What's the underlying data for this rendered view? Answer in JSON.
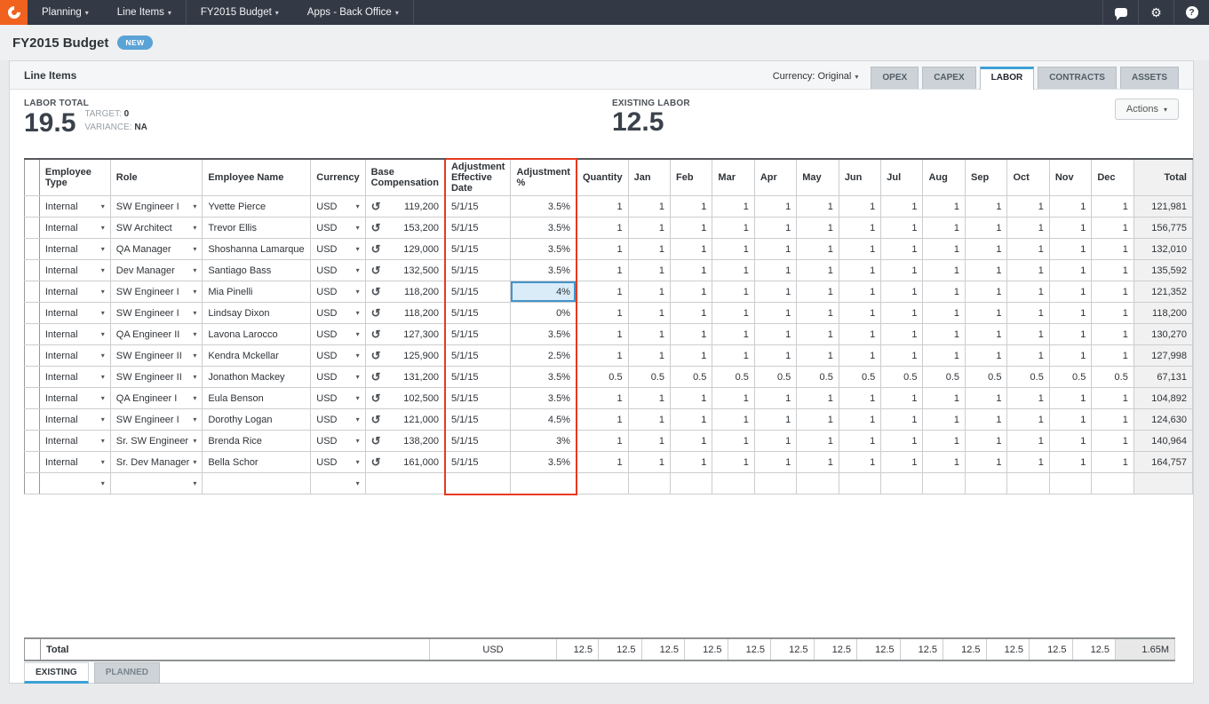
{
  "colors": {
    "navbar_bg": "#333a46",
    "logo_orange": "#f1621f",
    "badge_blue": "#5ba3d6",
    "active_tab_accent": "#3da0d5",
    "adjustment_columns_highlight": "#e8391f",
    "selected_cell_fill": "#d9ecf7",
    "selected_cell_border": "#4494cb"
  },
  "navbar": {
    "menu_groups": [
      {
        "items": [
          {
            "label": "Planning"
          },
          {
            "label": "Line Items"
          }
        ]
      },
      {
        "items": [
          {
            "label": "FY2015 Budget"
          },
          {
            "label": "Apps - Back Office"
          }
        ]
      }
    ],
    "icons": [
      "chat-icon",
      "gear-icon",
      "help-icon"
    ]
  },
  "page": {
    "title": "FY2015 Budget",
    "badge": "NEW"
  },
  "panel": {
    "title": "Line Items",
    "currency_label": "Currency: Original",
    "tabs": [
      {
        "label": "OPEX",
        "active": false
      },
      {
        "label": "CAPEX",
        "active": false
      },
      {
        "label": "LABOR",
        "active": true
      },
      {
        "label": "CONTRACTS",
        "active": false
      },
      {
        "label": "ASSETS",
        "active": false
      }
    ],
    "actions_label": "Actions"
  },
  "summary": {
    "labor_total_label": "LABOR TOTAL",
    "labor_total_value": "19.5",
    "target_label": "TARGET:",
    "target_value": "0",
    "variance_label": "VARIANCE:",
    "variance_value": "NA",
    "existing_labor_label": "EXISTING LABOR",
    "existing_labor_value": "12.5"
  },
  "grid": {
    "columns": {
      "employee_type": "Employee Type",
      "role": "Role",
      "employee_name": "Employee Name",
      "currency": "Currency",
      "base_compensation": "Base Compensation",
      "adjustment_effective_date": "Adjustment Effective Date",
      "adjustment_pct": "Adjustment %",
      "quantity": "Quantity",
      "months": [
        "Jan",
        "Feb",
        "Mar",
        "Apr",
        "May",
        "Jun",
        "Jul",
        "Aug",
        "Sep",
        "Oct",
        "Nov",
        "Dec"
      ],
      "total": "Total"
    },
    "rows": [
      {
        "employee_type": "Internal",
        "role": "SW Engineer I",
        "employee_name": "Yvette Pierce",
        "currency": "USD",
        "base_compensation": "119,200",
        "adjustment_effective_date": "5/1/15",
        "adjustment_pct": "3.5%",
        "quantity": "1",
        "months": [
          "1",
          "1",
          "1",
          "1",
          "1",
          "1",
          "1",
          "1",
          "1",
          "1",
          "1",
          "1"
        ],
        "total": "121,981",
        "selected": false
      },
      {
        "employee_type": "Internal",
        "role": "SW Architect",
        "employee_name": "Trevor Ellis",
        "currency": "USD",
        "base_compensation": "153,200",
        "adjustment_effective_date": "5/1/15",
        "adjustment_pct": "3.5%",
        "quantity": "1",
        "months": [
          "1",
          "1",
          "1",
          "1",
          "1",
          "1",
          "1",
          "1",
          "1",
          "1",
          "1",
          "1"
        ],
        "total": "156,775",
        "selected": false
      },
      {
        "employee_type": "Internal",
        "role": "QA Manager",
        "employee_name": "Shoshanna Lamarque",
        "currency": "USD",
        "base_compensation": "129,000",
        "adjustment_effective_date": "5/1/15",
        "adjustment_pct": "3.5%",
        "quantity": "1",
        "months": [
          "1",
          "1",
          "1",
          "1",
          "1",
          "1",
          "1",
          "1",
          "1",
          "1",
          "1",
          "1"
        ],
        "total": "132,010",
        "selected": false
      },
      {
        "employee_type": "Internal",
        "role": "Dev Manager",
        "employee_name": "Santiago Bass",
        "currency": "USD",
        "base_compensation": "132,500",
        "adjustment_effective_date": "5/1/15",
        "adjustment_pct": "3.5%",
        "quantity": "1",
        "months": [
          "1",
          "1",
          "1",
          "1",
          "1",
          "1",
          "1",
          "1",
          "1",
          "1",
          "1",
          "1"
        ],
        "total": "135,592",
        "selected": false
      },
      {
        "employee_type": "Internal",
        "role": "SW Engineer I",
        "employee_name": "Mia Pinelli",
        "currency": "USD",
        "base_compensation": "118,200",
        "adjustment_effective_date": "5/1/15",
        "adjustment_pct": "4%",
        "quantity": "1",
        "months": [
          "1",
          "1",
          "1",
          "1",
          "1",
          "1",
          "1",
          "1",
          "1",
          "1",
          "1",
          "1"
        ],
        "total": "121,352",
        "selected": true
      },
      {
        "employee_type": "Internal",
        "role": "SW Engineer I",
        "employee_name": "Lindsay Dixon",
        "currency": "USD",
        "base_compensation": "118,200",
        "adjustment_effective_date": "5/1/15",
        "adjustment_pct": "0%",
        "quantity": "1",
        "months": [
          "1",
          "1",
          "1",
          "1",
          "1",
          "1",
          "1",
          "1",
          "1",
          "1",
          "1",
          "1"
        ],
        "total": "118,200",
        "selected": false
      },
      {
        "employee_type": "Internal",
        "role": "QA Engineer II",
        "employee_name": "Lavona Larocco",
        "currency": "USD",
        "base_compensation": "127,300",
        "adjustment_effective_date": "5/1/15",
        "adjustment_pct": "3.5%",
        "quantity": "1",
        "months": [
          "1",
          "1",
          "1",
          "1",
          "1",
          "1",
          "1",
          "1",
          "1",
          "1",
          "1",
          "1"
        ],
        "total": "130,270",
        "selected": false
      },
      {
        "employee_type": "Internal",
        "role": "SW Engineer II",
        "employee_name": "Kendra Mckellar",
        "currency": "USD",
        "base_compensation": "125,900",
        "adjustment_effective_date": "5/1/15",
        "adjustment_pct": "2.5%",
        "quantity": "1",
        "months": [
          "1",
          "1",
          "1",
          "1",
          "1",
          "1",
          "1",
          "1",
          "1",
          "1",
          "1",
          "1"
        ],
        "total": "127,998",
        "selected": false
      },
      {
        "employee_type": "Internal",
        "role": "SW Engineer II",
        "employee_name": "Jonathon Mackey",
        "currency": "USD",
        "base_compensation": "131,200",
        "adjustment_effective_date": "5/1/15",
        "adjustment_pct": "3.5%",
        "quantity": "0.5",
        "months": [
          "0.5",
          "0.5",
          "0.5",
          "0.5",
          "0.5",
          "0.5",
          "0.5",
          "0.5",
          "0.5",
          "0.5",
          "0.5",
          "0.5"
        ],
        "total": "67,131",
        "selected": false
      },
      {
        "employee_type": "Internal",
        "role": "QA Engineer I",
        "employee_name": "Eula Benson",
        "currency": "USD",
        "base_compensation": "102,500",
        "adjustment_effective_date": "5/1/15",
        "adjustment_pct": "3.5%",
        "quantity": "1",
        "months": [
          "1",
          "1",
          "1",
          "1",
          "1",
          "1",
          "1",
          "1",
          "1",
          "1",
          "1",
          "1"
        ],
        "total": "104,892",
        "selected": false
      },
      {
        "employee_type": "Internal",
        "role": "SW Engineer I",
        "employee_name": "Dorothy Logan",
        "currency": "USD",
        "base_compensation": "121,000",
        "adjustment_effective_date": "5/1/15",
        "adjustment_pct": "4.5%",
        "quantity": "1",
        "months": [
          "1",
          "1",
          "1",
          "1",
          "1",
          "1",
          "1",
          "1",
          "1",
          "1",
          "1",
          "1"
        ],
        "total": "124,630",
        "selected": false
      },
      {
        "employee_type": "Internal",
        "role": "Sr. SW Engineer",
        "employee_name": "Brenda Rice",
        "currency": "USD",
        "base_compensation": "138,200",
        "adjustment_effective_date": "5/1/15",
        "adjustment_pct": "3%",
        "quantity": "1",
        "months": [
          "1",
          "1",
          "1",
          "1",
          "1",
          "1",
          "1",
          "1",
          "1",
          "1",
          "1",
          "1"
        ],
        "total": "140,964",
        "selected": false
      },
      {
        "employee_type": "Internal",
        "role": "Sr. Dev Manager",
        "employee_name": "Bella Schor",
        "currency": "USD",
        "base_compensation": "161,000",
        "adjustment_effective_date": "5/1/15",
        "adjustment_pct": "3.5%",
        "quantity": "1",
        "months": [
          "1",
          "1",
          "1",
          "1",
          "1",
          "1",
          "1",
          "1",
          "1",
          "1",
          "1",
          "1"
        ],
        "total": "164,757",
        "selected": false
      }
    ],
    "total_row": {
      "label": "Total",
      "currency": "USD",
      "quantity": "12.5",
      "months": [
        "12.5",
        "12.5",
        "12.5",
        "12.5",
        "12.5",
        "12.5",
        "12.5",
        "12.5",
        "12.5",
        "12.5",
        "12.5",
        "12.5"
      ],
      "total": "1.65M"
    }
  },
  "bottom_tabs": [
    {
      "label": "EXISTING",
      "active": true
    },
    {
      "label": "PLANNED",
      "active": false
    }
  ]
}
